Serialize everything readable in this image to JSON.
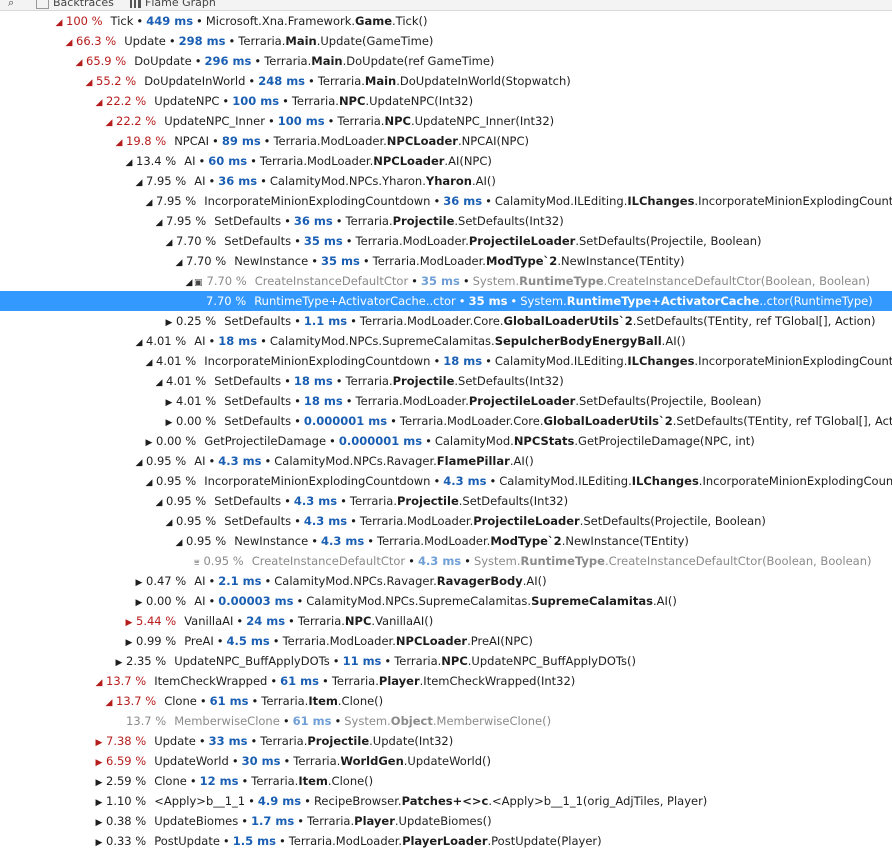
{
  "toolbar": {
    "backtraces_label": "Backtraces",
    "flamegraph_label": "Flame Graph"
  },
  "rows": [
    {
      "depth": 0,
      "toggle": "expanded",
      "hot": true,
      "pct": "100 %",
      "label": "Tick",
      "ms": "449 ms",
      "ns": "Microsoft.Xna.Framework.",
      "cls": "Game",
      "member": ".Tick()"
    },
    {
      "depth": 1,
      "toggle": "expanded",
      "hot": true,
      "pct": "66.3 %",
      "label": "Update",
      "ms": "298 ms",
      "ns": "Terraria.",
      "cls": "Main",
      "member": ".Update(GameTime)"
    },
    {
      "depth": 2,
      "toggle": "expanded",
      "hot": true,
      "pct": "65.9 %",
      "label": "DoUpdate",
      "ms": "296 ms",
      "ns": "Terraria.",
      "cls": "Main",
      "member": ".DoUpdate(ref GameTime)"
    },
    {
      "depth": 3,
      "toggle": "expanded",
      "hot": true,
      "pct": "55.2 %",
      "label": "DoUpdateInWorld",
      "ms": "248 ms",
      "ns": "Terraria.",
      "cls": "Main",
      "member": ".DoUpdateInWorld(Stopwatch)"
    },
    {
      "depth": 4,
      "toggle": "expanded",
      "hot": true,
      "pct": "22.2 %",
      "label": "UpdateNPC",
      "ms": "100 ms",
      "ns": "Terraria.",
      "cls": "NPC",
      "member": ".UpdateNPC(Int32)"
    },
    {
      "depth": 5,
      "toggle": "expanded",
      "hot": true,
      "pct": "22.2 %",
      "label": "UpdateNPC_Inner",
      "ms": "100 ms",
      "ns": "Terraria.",
      "cls": "NPC",
      "member": ".UpdateNPC_Inner(Int32)"
    },
    {
      "depth": 6,
      "toggle": "expanded",
      "hot": true,
      "pct": "19.8 %",
      "label": "NPCAI",
      "ms": "89 ms",
      "ns": "Terraria.ModLoader.",
      "cls": "NPCLoader",
      "member": ".NPCAI(NPC)"
    },
    {
      "depth": 7,
      "toggle": "expanded",
      "hot": false,
      "pct": "13.4 %",
      "label": "AI",
      "ms": "60 ms",
      "ns": "Terraria.ModLoader.",
      "cls": "NPCLoader",
      "member": ".AI(NPC)"
    },
    {
      "depth": 8,
      "toggle": "expanded",
      "hot": false,
      "pct": "7.95 %",
      "label": "AI",
      "ms": "36 ms",
      "ns": "CalamityMod.NPCs.Yharon.",
      "cls": "Yharon",
      "member": ".AI()"
    },
    {
      "depth": 9,
      "toggle": "expanded",
      "hot": false,
      "pct": "7.95 %",
      "label": "IncorporateMinionExplodingCountdown",
      "ms": "36 ms",
      "ns": "CalamityMod.ILEditing.",
      "cls": "ILChanges",
      "member": ".IncorporateMinionExplodingCountdown(orig_"
    },
    {
      "depth": 10,
      "toggle": "expanded",
      "hot": false,
      "pct": "7.95 %",
      "label": "SetDefaults",
      "ms": "36 ms",
      "ns": "Terraria.",
      "cls": "Projectile",
      "member": ".SetDefaults(Int32)"
    },
    {
      "depth": 11,
      "toggle": "expanded",
      "hot": false,
      "pct": "7.70 %",
      "label": "SetDefaults",
      "ms": "35 ms",
      "ns": "Terraria.ModLoader.",
      "cls": "ProjectileLoader",
      "member": ".SetDefaults(Projectile, Boolean)"
    },
    {
      "depth": 12,
      "toggle": "expanded",
      "hot": false,
      "pct": "7.70 %",
      "label": "NewInstance",
      "ms": "35 ms",
      "ns": "Terraria.ModLoader.",
      "cls": "ModType`2",
      "member": ".NewInstance(TEntity)"
    },
    {
      "depth": 13,
      "toggle": "expanded",
      "hot": false,
      "badge": "▣",
      "dim": true,
      "pct": "7.70 %",
      "label": "CreateInstanceDefaultCtor",
      "ms": "35 ms",
      "ns": "System.",
      "cls": "RuntimeType",
      "member": ".CreateInstanceDefaultCtor(Boolean, Boolean)"
    },
    {
      "depth": 14,
      "toggle": "none",
      "hot": false,
      "selected": true,
      "pct": "7.70 %",
      "label": "RuntimeType+ActivatorCache..ctor",
      "ms": "35 ms",
      "ns": "System.",
      "cls": "RuntimeType+ActivatorCache",
      "member": "..ctor(RuntimeType)"
    },
    {
      "depth": 11,
      "toggle": "collapsed",
      "hot": false,
      "pct": "0.25 %",
      "label": "SetDefaults",
      "ms": "1.1 ms",
      "ns": "Terraria.ModLoader.Core.",
      "cls": "GlobalLoaderUtils`2",
      "member": ".SetDefaults(TEntity, ref TGlobal[], Action)"
    },
    {
      "depth": 8,
      "toggle": "expanded",
      "hot": false,
      "pct": "4.01 %",
      "label": "AI",
      "ms": "18 ms",
      "ns": "CalamityMod.NPCs.SupremeCalamitas.",
      "cls": "SepulcherBodyEnergyBall",
      "member": ".AI()"
    },
    {
      "depth": 9,
      "toggle": "expanded",
      "hot": false,
      "pct": "4.01 %",
      "label": "IncorporateMinionExplodingCountdown",
      "ms": "18 ms",
      "ns": "CalamityMod.ILEditing.",
      "cls": "ILChanges",
      "member": ".IncorporateMinionExplodingCountdown(orig_I"
    },
    {
      "depth": 10,
      "toggle": "expanded",
      "hot": false,
      "pct": "4.01 %",
      "label": "SetDefaults",
      "ms": "18 ms",
      "ns": "Terraria.",
      "cls": "Projectile",
      "member": ".SetDefaults(Int32)"
    },
    {
      "depth": 11,
      "toggle": "collapsed",
      "hot": false,
      "pct": "4.01 %",
      "label": "SetDefaults",
      "ms": "18 ms",
      "ns": "Terraria.ModLoader.",
      "cls": "ProjectileLoader",
      "member": ".SetDefaults(Projectile, Boolean)"
    },
    {
      "depth": 11,
      "toggle": "collapsed",
      "hot": false,
      "pct": "0.00 %",
      "label": "SetDefaults",
      "ms": "0.000001 ms",
      "ns": "Terraria.ModLoader.Core.",
      "cls": "GlobalLoaderUtils`2",
      "member": ".SetDefaults(TEntity, ref TGlobal[], Action)"
    },
    {
      "depth": 9,
      "toggle": "collapsed",
      "hot": false,
      "pct": "0.00 %",
      "label": "GetProjectileDamage",
      "ms": "0.000001 ms",
      "ns": "CalamityMod.",
      "cls": "NPCStats",
      "member": ".GetProjectileDamage(NPC, int)"
    },
    {
      "depth": 8,
      "toggle": "expanded",
      "hot": false,
      "pct": "0.95 %",
      "label": "AI",
      "ms": "4.3 ms",
      "ns": "CalamityMod.NPCs.Ravager.",
      "cls": "FlamePillar",
      "member": ".AI()"
    },
    {
      "depth": 9,
      "toggle": "expanded",
      "hot": false,
      "pct": "0.95 %",
      "label": "IncorporateMinionExplodingCountdown",
      "ms": "4.3 ms",
      "ns": "CalamityMod.ILEditing.",
      "cls": "ILChanges",
      "member": ".IncorporateMinionExplodingCountdown(orig"
    },
    {
      "depth": 10,
      "toggle": "expanded",
      "hot": false,
      "pct": "0.95 %",
      "label": "SetDefaults",
      "ms": "4.3 ms",
      "ns": "Terraria.",
      "cls": "Projectile",
      "member": ".SetDefaults(Int32)"
    },
    {
      "depth": 11,
      "toggle": "expanded",
      "hot": false,
      "pct": "0.95 %",
      "label": "SetDefaults",
      "ms": "4.3 ms",
      "ns": "Terraria.ModLoader.",
      "cls": "ProjectileLoader",
      "member": ".SetDefaults(Projectile, Boolean)"
    },
    {
      "depth": 12,
      "toggle": "expanded",
      "hot": false,
      "pct": "0.95 %",
      "label": "NewInstance",
      "ms": "4.3 ms",
      "ns": "Terraria.ModLoader.",
      "cls": "ModType`2",
      "member": ".NewInstance(TEntity)"
    },
    {
      "depth": 13,
      "toggle": "none",
      "hot": false,
      "badge": "⩸",
      "dim": true,
      "pct": "0.95 %",
      "label": "CreateInstanceDefaultCtor",
      "ms": "4.3 ms",
      "ns": "System.",
      "cls": "RuntimeType",
      "member": ".CreateInstanceDefaultCtor(Boolean, Boolean)"
    },
    {
      "depth": 8,
      "toggle": "collapsed",
      "hot": false,
      "pct": "0.47 %",
      "label": "AI",
      "ms": "2.1 ms",
      "ns": "CalamityMod.NPCs.Ravager.",
      "cls": "RavagerBody",
      "member": ".AI()"
    },
    {
      "depth": 8,
      "toggle": "collapsed",
      "hot": false,
      "pct": "0.00 %",
      "label": "AI",
      "ms": "0.00003 ms",
      "ns": "CalamityMod.NPCs.SupremeCalamitas.",
      "cls": "SupremeCalamitas",
      "member": ".AI()"
    },
    {
      "depth": 7,
      "toggle": "collapsed",
      "hot": true,
      "pct": "5.44 %",
      "label": "VanillaAI",
      "ms": "24 ms",
      "ns": "Terraria.",
      "cls": "NPC",
      "member": ".VanillaAI()"
    },
    {
      "depth": 7,
      "toggle": "collapsed",
      "hot": false,
      "pct": "0.99 %",
      "label": "PreAI",
      "ms": "4.5 ms",
      "ns": "Terraria.ModLoader.",
      "cls": "NPCLoader",
      "member": ".PreAI(NPC)"
    },
    {
      "depth": 6,
      "toggle": "collapsed",
      "hot": false,
      "pct": "2.35 %",
      "label": "UpdateNPC_BuffApplyDOTs",
      "ms": "11 ms",
      "ns": "Terraria.",
      "cls": "NPC",
      "member": ".UpdateNPC_BuffApplyDOTs()"
    },
    {
      "depth": 4,
      "toggle": "expanded",
      "hot": true,
      "pct": "13.7 %",
      "label": "ItemCheckWrapped",
      "ms": "61 ms",
      "ns": "Terraria.",
      "cls": "Player",
      "member": ".ItemCheckWrapped(Int32)"
    },
    {
      "depth": 5,
      "toggle": "expanded",
      "hot": true,
      "pct": "13.7 %",
      "label": "Clone",
      "ms": "61 ms",
      "ns": "Terraria.",
      "cls": "Item",
      "member": ".Clone()"
    },
    {
      "depth": 6,
      "toggle": "none",
      "hot": false,
      "dim": true,
      "pct": "13.7 %",
      "label": "MemberwiseClone",
      "ms": "61 ms",
      "ns": "System.",
      "cls": "Object",
      "member": ".MemberwiseClone()"
    },
    {
      "depth": 4,
      "toggle": "collapsed",
      "hot": true,
      "pct": "7.38 %",
      "label": "Update",
      "ms": "33 ms",
      "ns": "Terraria.",
      "cls": "Projectile",
      "member": ".Update(Int32)"
    },
    {
      "depth": 4,
      "toggle": "collapsed",
      "hot": true,
      "pct": "6.59 %",
      "label": "UpdateWorld",
      "ms": "30 ms",
      "ns": "Terraria.",
      "cls": "WorldGen",
      "member": ".UpdateWorld()"
    },
    {
      "depth": 4,
      "toggle": "collapsed",
      "hot": false,
      "pct": "2.59 %",
      "label": "Clone",
      "ms": "12 ms",
      "ns": "Terraria.",
      "cls": "Item",
      "member": ".Clone()"
    },
    {
      "depth": 4,
      "toggle": "collapsed",
      "hot": false,
      "pct": "1.10 %",
      "label": "<Apply>b__1_1",
      "ms": "4.9 ms",
      "ns": "RecipeBrowser.",
      "cls": "Patches+<>c",
      "member": ".<Apply>b__1_1(orig_AdjTiles, Player)"
    },
    {
      "depth": 4,
      "toggle": "collapsed",
      "hot": false,
      "pct": "0.38 %",
      "label": "UpdateBiomes",
      "ms": "1.7 ms",
      "ns": "Terraria.",
      "cls": "Player",
      "member": ".UpdateBiomes()"
    },
    {
      "depth": 4,
      "toggle": "collapsed",
      "hot": false,
      "pct": "0.33 %",
      "label": "PostUpdate",
      "ms": "1.5 ms",
      "ns": "Terraria.ModLoader.",
      "cls": "PlayerLoader",
      "member": ".PostUpdate(Player)"
    }
  ]
}
